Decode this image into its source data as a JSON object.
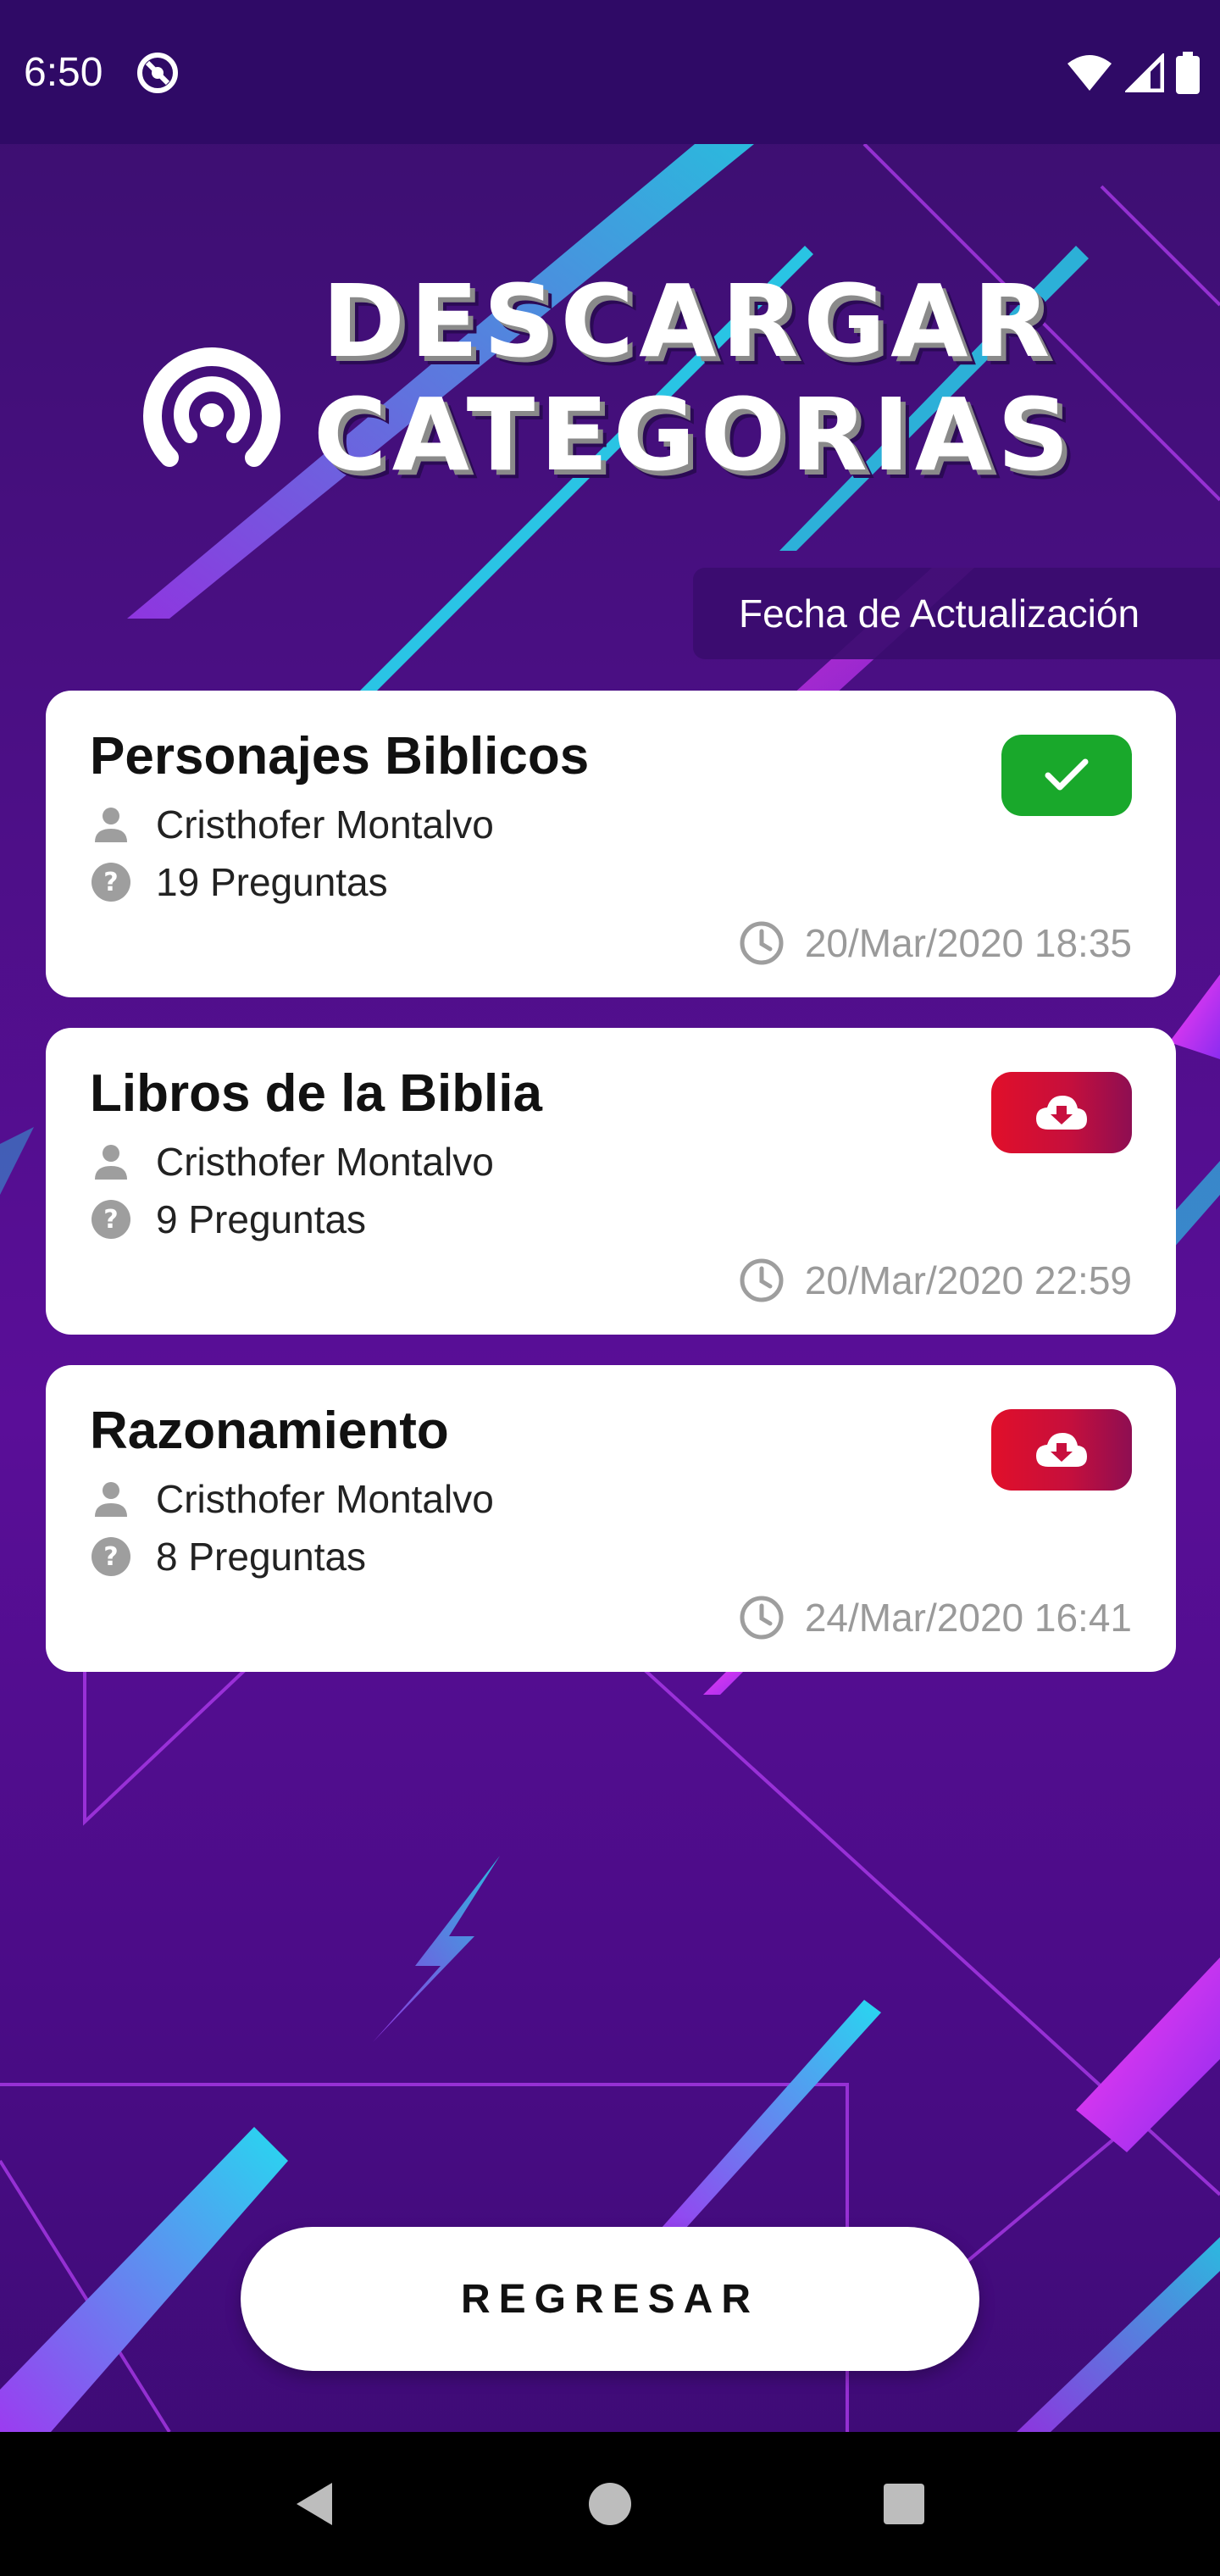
{
  "status_bar": {
    "time": "6:50"
  },
  "header": {
    "title_line1": "DESCARGAR",
    "title_line2": "CATEGORIAS",
    "icon": "podcast-icon"
  },
  "update_chip": {
    "label": "Fecha de Actualización"
  },
  "categories": [
    {
      "title": "Personajes Biblicos",
      "author": "Cristhofer Montalvo",
      "questions": "19 Preguntas",
      "date": "20/Mar/2020 18:35",
      "status": "downloaded",
      "status_icon": "check-icon",
      "status_color": "#19a82b"
    },
    {
      "title": "Libros de la Biblia",
      "author": "Cristhofer Montalvo",
      "questions": "9 Preguntas",
      "date": "20/Mar/2020 22:59",
      "status": "download",
      "status_icon": "cloud-download-icon",
      "status_color": "#e10f2a"
    },
    {
      "title": "Razonamiento",
      "author": "Cristhofer Montalvo",
      "questions": "8 Preguntas",
      "date": "24/Mar/2020 16:41",
      "status": "download",
      "status_icon": "cloud-download-icon",
      "status_color": "#e10f2a"
    }
  ],
  "back_button": {
    "label": "REGRESAR"
  },
  "colors": {
    "background": "#4c0f86",
    "status_bar": "#2f0a66",
    "card": "#ffffff",
    "accent_cyan": "#27d8f0",
    "accent_magenta": "#e02cf0"
  }
}
